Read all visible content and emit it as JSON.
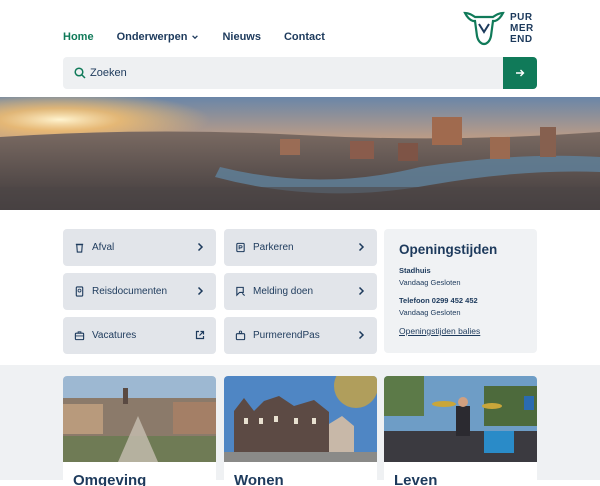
{
  "header": {
    "nav": [
      {
        "label": "Home",
        "active": true
      },
      {
        "label": "Onderwerpen",
        "dropdown": true
      },
      {
        "label": "Nieuws"
      },
      {
        "label": "Contact"
      }
    ],
    "logo": {
      "line1": "PUR",
      "line2": "MER",
      "line3": "END"
    }
  },
  "search": {
    "placeholder": "Zoeken",
    "button_icon": "arrow-right-icon"
  },
  "quick_links": [
    {
      "label": "Afval",
      "icon": "trash-icon",
      "arrow": "chevron-right-icon"
    },
    {
      "label": "Parkeren",
      "icon": "parking-icon",
      "arrow": "chevron-right-icon"
    },
    {
      "label": "Reisdocumenten",
      "icon": "passport-icon",
      "arrow": "chevron-right-icon"
    },
    {
      "label": "Melding doen",
      "icon": "report-icon",
      "arrow": "chevron-right-icon"
    },
    {
      "label": "Vacatures",
      "icon": "briefcase-icon",
      "arrow": "external-link-icon"
    },
    {
      "label": "PurmerendPas",
      "icon": "card-icon",
      "arrow": "chevron-right-icon"
    }
  ],
  "opening_hours": {
    "title": "Openingstijden",
    "entries": [
      {
        "label": "Stadhuis",
        "status": "Vandaag Gesloten"
      },
      {
        "label": "Telefoon 0299 452 452",
        "status": "Vandaag Gesloten"
      }
    ],
    "link": "Openingstijden balies"
  },
  "cards": [
    {
      "title": "Omgeving"
    },
    {
      "title": "Wonen"
    },
    {
      "title": "Leven"
    }
  ],
  "colors": {
    "brand_green": "#107a59",
    "navy": "#1d3a5c",
    "tile_bg": "#e2e5ea"
  }
}
